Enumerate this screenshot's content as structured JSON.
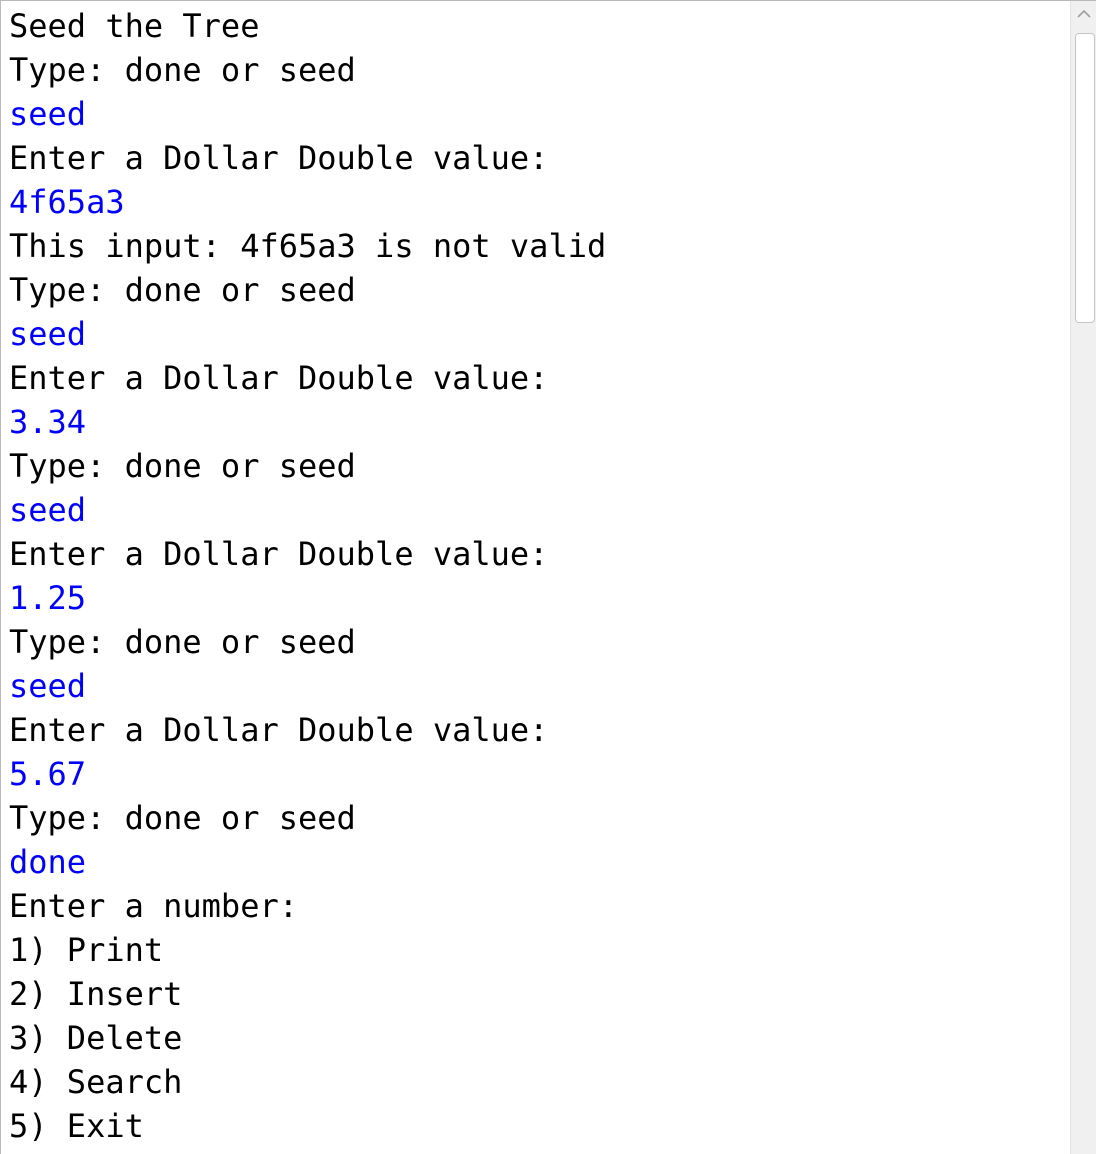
{
  "console": {
    "lines": [
      {
        "text": "Seed the Tree",
        "kind": "output"
      },
      {
        "text": "Type: done or seed",
        "kind": "output"
      },
      {
        "text": "seed",
        "kind": "input"
      },
      {
        "text": "Enter a Dollar Double value:",
        "kind": "output"
      },
      {
        "text": "4f65a3",
        "kind": "input"
      },
      {
        "text": "This input: 4f65a3 is not valid",
        "kind": "output"
      },
      {
        "text": "Type: done or seed",
        "kind": "output"
      },
      {
        "text": "seed",
        "kind": "input"
      },
      {
        "text": "Enter a Dollar Double value:",
        "kind": "output"
      },
      {
        "text": "3.34",
        "kind": "input"
      },
      {
        "text": "Type: done or seed",
        "kind": "output"
      },
      {
        "text": "seed",
        "kind": "input"
      },
      {
        "text": "Enter a Dollar Double value:",
        "kind": "output"
      },
      {
        "text": "1.25",
        "kind": "input"
      },
      {
        "text": "Type: done or seed",
        "kind": "output"
      },
      {
        "text": "seed",
        "kind": "input"
      },
      {
        "text": "Enter a Dollar Double value:",
        "kind": "output"
      },
      {
        "text": "5.67",
        "kind": "input"
      },
      {
        "text": "Type: done or seed",
        "kind": "output"
      },
      {
        "text": "done",
        "kind": "input"
      },
      {
        "text": "Enter a number:",
        "kind": "output"
      },
      {
        "text": "1) Print",
        "kind": "output"
      },
      {
        "text": "2) Insert",
        "kind": "output"
      },
      {
        "text": "3) Delete",
        "kind": "output"
      },
      {
        "text": "4) Search",
        "kind": "output"
      },
      {
        "text": "5) Exit",
        "kind": "output"
      }
    ]
  },
  "colors": {
    "output_text": "#000000",
    "input_text": "#0000ff",
    "background": "#ffffff"
  },
  "icons": {
    "scroll_up": "chevron-up-icon"
  }
}
